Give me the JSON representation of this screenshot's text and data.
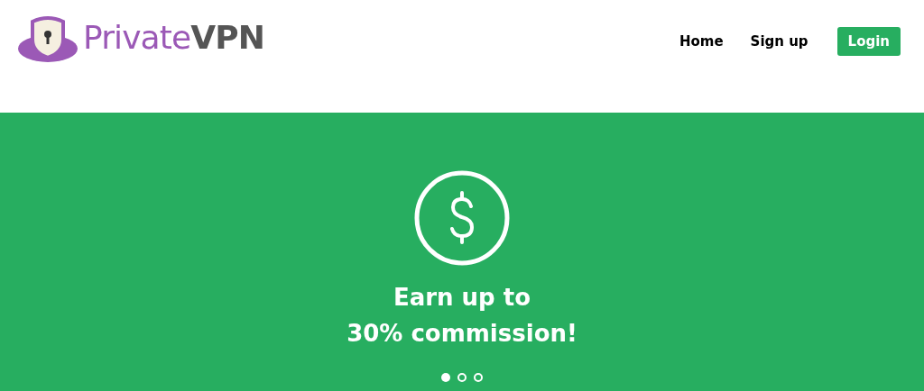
{
  "logo": {
    "wordmark": [
      "Private",
      "VPN"
    ]
  },
  "nav": [
    {
      "label": "Home",
      "kind": "link"
    },
    {
      "label": "Sign up",
      "kind": "link"
    },
    {
      "label": "Login",
      "kind": "button"
    }
  ],
  "hero": {
    "heading_lines": [
      "Earn up to",
      "30% commission!"
    ],
    "slides": [
      {
        "selected": true
      },
      {
        "selected": false
      },
      {
        "selected": false
      }
    ]
  }
}
